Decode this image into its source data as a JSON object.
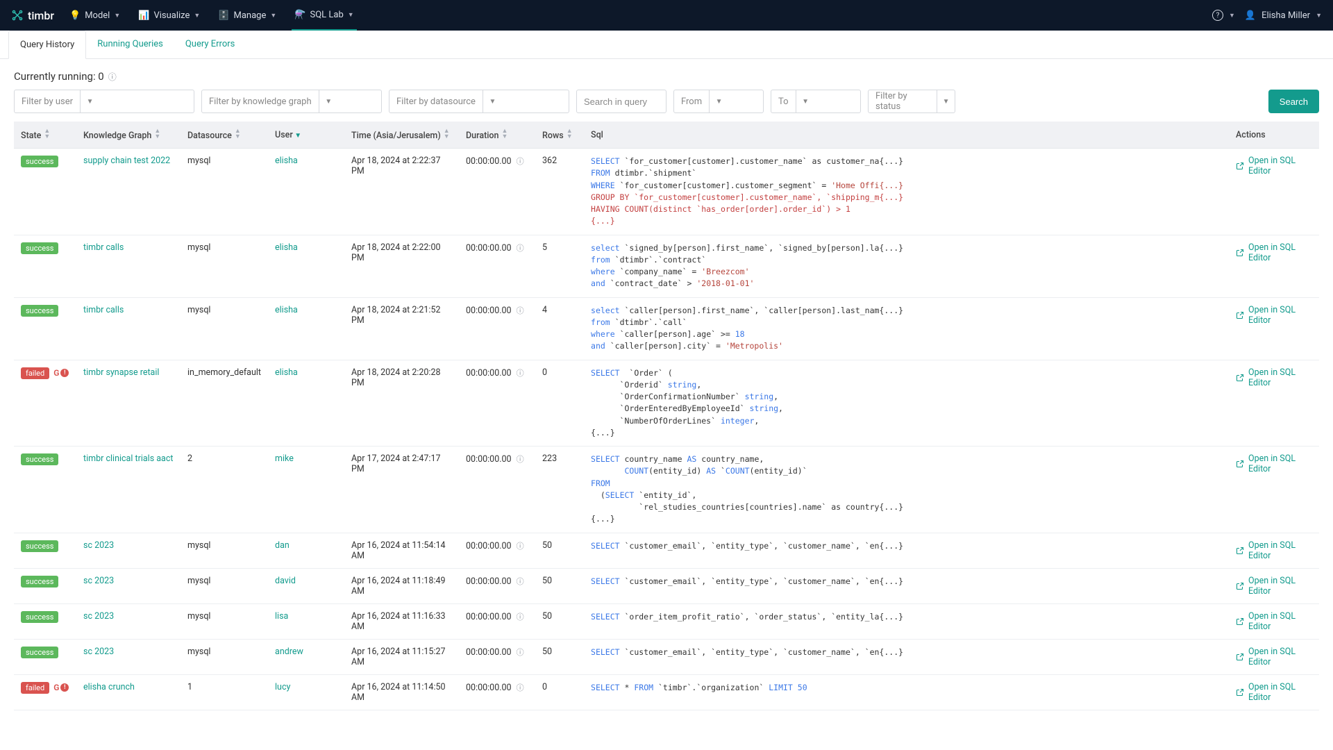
{
  "brand": "timbr",
  "nav": {
    "model": "Model",
    "visualize": "Visualize",
    "manage": "Manage",
    "sqllab": "SQL Lab"
  },
  "user": {
    "name": "Elisha Miller"
  },
  "tabs": {
    "history": "Query History",
    "running": "Running Queries",
    "errors": "Query Errors"
  },
  "running_label": "Currently running: 0",
  "filters": {
    "user_ph": "Filter by user",
    "kg_ph": "Filter by knowledge graph",
    "ds_ph": "Filter by datasource",
    "search_ph": "Search in query",
    "from_ph": "From",
    "to_ph": "To",
    "status_ph": "Filter by status",
    "search_btn": "Search"
  },
  "columns": {
    "state": "State",
    "kg": "Knowledge Graph",
    "ds": "Datasource",
    "user": "User",
    "time": "Time (Asia/Jerusalem)",
    "dur": "Duration",
    "rows": "Rows",
    "sql": "Sql",
    "actions": "Actions"
  },
  "action_label": "Open in SQL Editor",
  "rows": [
    {
      "state": "success",
      "kg": "supply chain test 2022",
      "ds": "mysql",
      "user": "elisha",
      "time": "Apr 18, 2024 at 2:22:37 PM",
      "dur": "00:00:00.00",
      "rows": "362",
      "sql_html": "<span class='kw'>SELECT</span> `for_customer[customer].customer_name` as customer_na{...}\n<span class='kw'>FROM</span> dtimbr.`shipment`\n<span class='kw'>WHERE</span> `for_customer[customer].customer_segment` = <span class='str'>'Home Offi{...}</span>\n<span class='hl'>GROUP BY `for_customer[customer].customer_name`, `shipping_m{...}</span>\n<span class='hl'>HAVING COUNT(distinct `has_order[order].order_id`) &gt; 1</span>\n<span class='hl'>{...}</span>"
    },
    {
      "state": "success",
      "kg": "timbr calls",
      "ds": "mysql",
      "user": "elisha",
      "time": "Apr 18, 2024 at 2:22:00 PM",
      "dur": "00:00:00.00",
      "rows": "5",
      "sql_html": "<span class='kw'>select</span> `signed_by[person].first_name`, `signed_by[person].la{...}\n<span class='kw'>from</span> `dtimbr`.`contract`\n<span class='kw'>where</span> `company_name` = <span class='str'>'Breezcom'</span>\n<span class='kw'>and</span> `contract_date` &gt; <span class='str'>'2018-01-01'</span>"
    },
    {
      "state": "success",
      "kg": "timbr calls",
      "ds": "mysql",
      "user": "elisha",
      "time": "Apr 18, 2024 at 2:21:52 PM",
      "dur": "00:00:00.00",
      "rows": "4",
      "sql_html": "<span class='kw'>select</span> `caller[person].first_name`, `caller[person].last_nam{...}\n<span class='kw'>from</span> `dtimbr`.`call`\n<span class='kw'>where</span> `caller[person].age` &gt;= <span class='num'>18</span>\n<span class='kw'>and</span> `caller[person].city` = <span class='str'>'Metropolis'</span>"
    },
    {
      "state": "failed",
      "kg": "timbr synapse retail",
      "ds": "in_memory_default",
      "user": "elisha",
      "time": "Apr 18, 2024 at 2:20:28 PM",
      "dur": "00:00:00.00",
      "rows": "0",
      "err": true,
      "sql_html": "<span class='kw'>SELECT</span>  `Order` (\n      `Orderid` <span class='kw'>string</span>,\n      `OrderConfirmationNumber` <span class='kw'>string</span>,\n      `OrderEnteredByEmployeeId` <span class='kw'>string</span>,\n      `NumberOfOrderLines` <span class='kw'>integer</span>,\n{...}"
    },
    {
      "state": "success",
      "kg": "timbr clinical trials aact",
      "ds": "2",
      "user": "mike",
      "time": "Apr 17, 2024 at 2:47:17 PM",
      "dur": "00:00:00.00",
      "rows": "223",
      "sql_html": "<span class='kw'>SELECT</span> country_name <span class='kw'>AS</span> country_name,\n       <span class='kw'>COUNT</span>(entity_id) <span class='kw'>AS</span> `<span class='kw'>COUNT</span>(entity_id)`\n<span class='kw'>FROM</span>\n  (<span class='kw'>SELECT</span> `entity_id`,\n          `rel_studies_countries[countries].name` as country{...}\n{...}"
    },
    {
      "state": "success",
      "kg": "sc 2023",
      "ds": "mysql",
      "user": "dan",
      "time": "Apr 16, 2024 at 11:54:14 AM",
      "dur": "00:00:00.00",
      "rows": "50",
      "sql_html": "<span class='kw'>SELECT</span> `customer_email`, `entity_type`, `customer_name`, `en{...}"
    },
    {
      "state": "success",
      "kg": "sc 2023",
      "ds": "mysql",
      "user": "david",
      "time": "Apr 16, 2024 at 11:18:49 AM",
      "dur": "00:00:00.00",
      "rows": "50",
      "sql_html": "<span class='kw'>SELECT</span> `customer_email`, `entity_type`, `customer_name`, `en{...}"
    },
    {
      "state": "success",
      "kg": "sc 2023",
      "ds": "mysql",
      "user": "lisa",
      "time": "Apr 16, 2024 at 11:16:33 AM",
      "dur": "00:00:00.00",
      "rows": "50",
      "sql_html": "<span class='kw'>SELECT</span> `order_item_profit_ratio`, `order_status`, `entity_la{...}"
    },
    {
      "state": "success",
      "kg": "sc 2023",
      "ds": "mysql",
      "user": "andrew",
      "time": "Apr 16, 2024 at 11:15:27 AM",
      "dur": "00:00:00.00",
      "rows": "50",
      "sql_html": "<span class='kw'>SELECT</span> `customer_email`, `entity_type`, `customer_name`, `en{...}"
    },
    {
      "state": "failed",
      "kg": "elisha crunch",
      "ds": "1",
      "user": "lucy",
      "err": true,
      "time": "Apr 16, 2024 at 11:14:50 AM",
      "dur": "00:00:00.00",
      "rows": "0",
      "sql_html": "<span class='kw'>SELECT</span> * <span class='kw'>FROM</span> `timbr`.`organization` <span class='kw'>LIMIT</span> <span class='num'>50</span>"
    }
  ]
}
